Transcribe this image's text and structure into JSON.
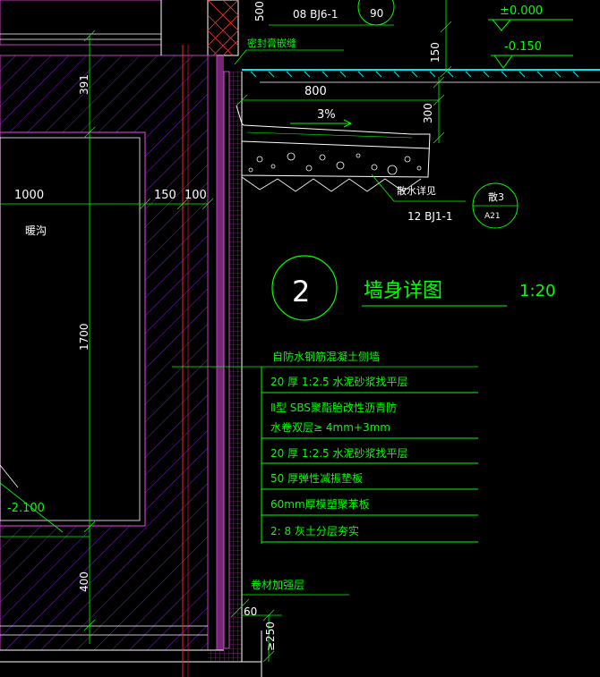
{
  "drawing": {
    "detail_number": "2",
    "title": "墙身详图",
    "scale": "1:20"
  },
  "top_labels": {
    "ref_std_top": "08 BJ6-1",
    "ref_circle_top": "90",
    "elev_zero": "±0.000",
    "elev_minus": "-0.150",
    "dim_500": "500",
    "dim_150": "150",
    "seal_note": "密封膏嵌缝"
  },
  "apron": {
    "width": "800",
    "slope": "3%",
    "depth": "300",
    "note": "散水详见",
    "std": "12 BJ1-1",
    "ref_no": "散3",
    "ref_sheet": "A21"
  },
  "trench": {
    "dim_391": "391",
    "dim_1000": "1000",
    "dim_150": "150",
    "dim_100": "100",
    "name": "暖沟",
    "dim_1700": "1700",
    "elev": "-2.100",
    "dim_400": "400"
  },
  "layers": [
    "自防水钢筋混凝土侧墙",
    "20 厚 1:2.5   水泥砂浆找平层",
    "Ⅱ型   SBS聚酯胎改性沥青防",
    "水卷双层≥           4mm+3mm",
    "20 厚 1:2.5   水泥砂浆找平层",
    "50 厚弹性减振垫板",
    "60mm厚模塑聚苯板",
    "2:  8 灰土分层夯实"
  ],
  "bottom": {
    "reinforce": "卷材加强层",
    "dim_60": "60",
    "dim_250": "≥250"
  },
  "colors": {
    "background": "#000000",
    "line": "#00ff00",
    "text_white": "#ffffff",
    "hatch": "#8a2be2",
    "wall": "#c040c0",
    "red_axis": "#ff2020",
    "ground": "#00e5e5"
  }
}
